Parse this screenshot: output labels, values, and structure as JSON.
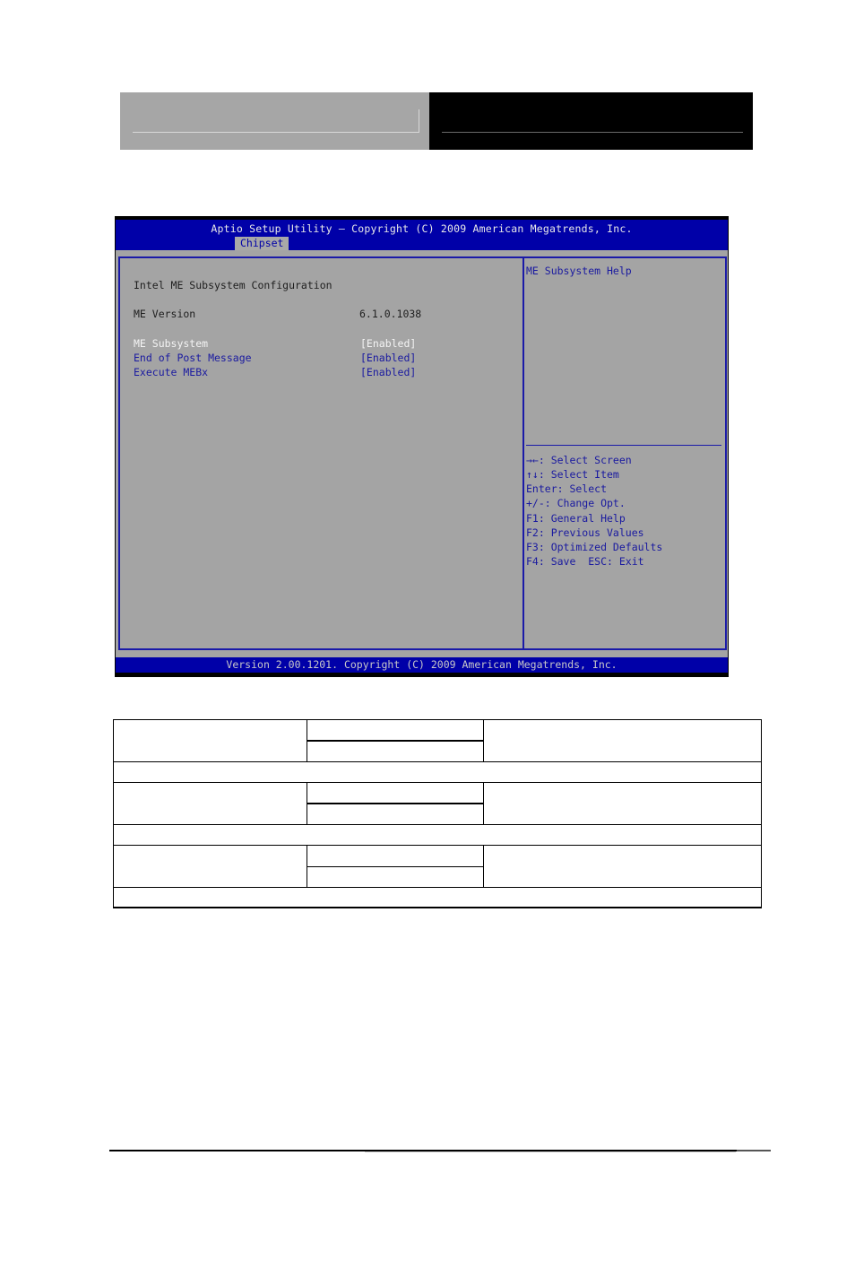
{
  "bios": {
    "title": "Aptio Setup Utility – Copyright (C) 2009 American Megatrends, Inc.",
    "active_tab": "Chipset",
    "section_heading": "Intel ME Subsystem Configuration",
    "info": [
      {
        "label": "ME Version",
        "value": "6.1.0.1038"
      }
    ],
    "options": [
      {
        "label": "ME Subsystem",
        "value": "[Enabled]",
        "selected": true
      },
      {
        "label": "End of Post Message",
        "value": "[Enabled]",
        "selected": false
      },
      {
        "label": "Execute MEBx",
        "value": "[Enabled]",
        "selected": false
      }
    ],
    "help_text": "ME Subsystem Help",
    "key_help": [
      "→←: Select Screen",
      "↑↓: Select Item",
      "Enter: Select",
      "+/-: Change Opt.",
      "F1: General Help",
      "F2: Previous Values",
      "F3: Optimized Defaults",
      "F4: Save  ESC: Exit"
    ],
    "footer": "Version 2.00.1201. Copyright (C) 2009 American Megatrends, Inc."
  },
  "colors": {
    "bios_blue": "#0000a8",
    "bios_grey": "#a4a4a4",
    "highlight_text": "#f4f4f4",
    "option_text": "#1a1aa0"
  }
}
